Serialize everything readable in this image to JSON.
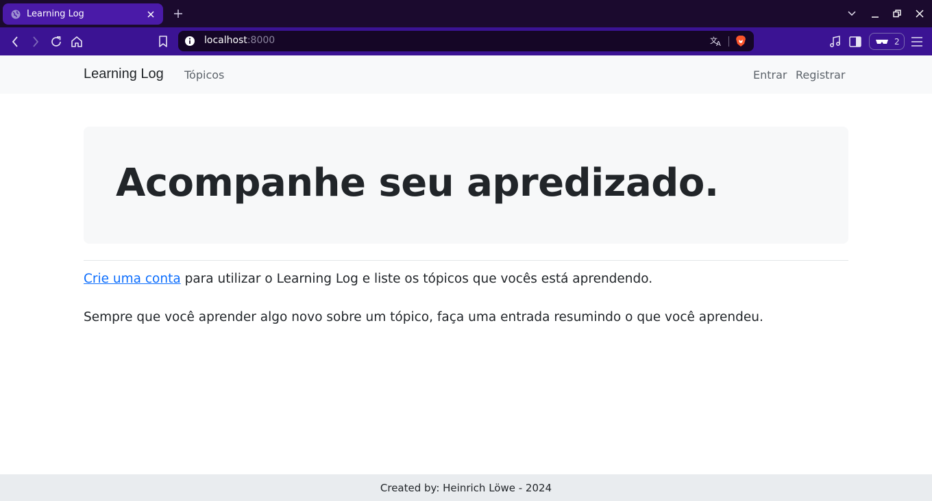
{
  "browser": {
    "tab_title": "Learning Log",
    "url_host": "localhost",
    "url_port": ":8000",
    "vpn_count": "2",
    "icons": [
      "globe-icon",
      "close-icon",
      "plus-icon",
      "chevron-down-icon",
      "minimize-icon",
      "restore-icon",
      "window-close-icon",
      "back-icon",
      "forward-icon",
      "reload-icon",
      "home-icon",
      "bookmark-icon",
      "info-icon",
      "translate-icon",
      "brave-shield-icon",
      "music-icon",
      "sidebar-icon",
      "vpn-icon",
      "menu-icon"
    ],
    "colors": {
      "tabbar": "#1b0a2e",
      "tab_active": "#4a1aa8",
      "toolbar": "#3b1393",
      "urlbar": "#150626"
    }
  },
  "navbar": {
    "brand": "Learning Log",
    "topics": "Tópicos",
    "login": "Entrar",
    "register": "Registrar"
  },
  "hero": {
    "heading": "Acompanhe seu apredizado."
  },
  "content": {
    "create_account_link": "Crie uma conta",
    "para1_rest": " para utilizar o Learning Log e liste os tópicos que vocês está aprendendo.",
    "para2": "Sempre que você aprender algo novo sobre um tópico, faça uma entrada resumindo o que você aprendeu."
  },
  "footer": {
    "text": "Created by: Heinrich Löwe - 2024"
  },
  "colors": {
    "link": "#0d6efd",
    "navbar_bg": "#f8f9fa",
    "hero_bg": "#f7f8f9",
    "footer_bg": "#e9ecef"
  }
}
